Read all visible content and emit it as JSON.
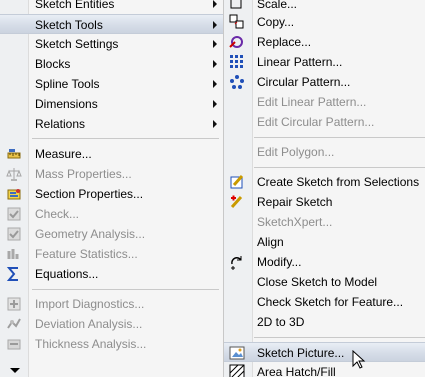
{
  "left_menu": {
    "items": [
      {
        "label": "Sketch Entities",
        "submenu": true
      },
      {
        "label": "Sketch Tools",
        "submenu": true,
        "highlighted": true
      },
      {
        "label": "Sketch Settings",
        "submenu": true
      },
      {
        "label": "Blocks",
        "submenu": true
      },
      {
        "label": "Spline Tools",
        "submenu": true
      },
      {
        "label": "Dimensions",
        "submenu": true
      },
      {
        "label": "Relations",
        "submenu": true
      },
      {
        "label": "Measure...",
        "icon": "measure-icon"
      },
      {
        "label": "Mass Properties...",
        "icon": "mass-properties-icon",
        "disabled": true
      },
      {
        "label": "Section Properties...",
        "icon": "section-properties-icon"
      },
      {
        "label": "Check...",
        "icon": "check-icon",
        "disabled": true
      },
      {
        "label": "Geometry Analysis...",
        "icon": "geometry-analysis-icon",
        "disabled": true
      },
      {
        "label": "Feature Statistics...",
        "icon": "feature-statistics-icon",
        "disabled": true
      },
      {
        "label": "Equations...",
        "icon": "sigma-icon"
      },
      {
        "label": "Import Diagnostics...",
        "icon": "import-diagnostics-icon",
        "disabled": true
      },
      {
        "label": "Deviation  Analysis...",
        "icon": "deviation-analysis-icon",
        "disabled": true
      },
      {
        "label": "Thickness Analysis...",
        "icon": "thickness-analysis-icon",
        "disabled": true
      }
    ]
  },
  "right_menu": {
    "items": [
      {
        "label": "Scale...",
        "icon": "scale-icon"
      },
      {
        "label": "Copy...",
        "icon": "copy-icon"
      },
      {
        "label": "Replace...",
        "icon": "replace-icon"
      },
      {
        "label": "Linear Pattern...",
        "icon": "linear-pattern-icon"
      },
      {
        "label": "Circular Pattern...",
        "icon": "circular-pattern-icon"
      },
      {
        "label": "Edit Linear Pattern...",
        "disabled": true
      },
      {
        "label": "Edit Circular Pattern...",
        "disabled": true
      },
      {
        "label": "Edit Polygon...",
        "disabled": true
      },
      {
        "label": "Create Sketch from Selections",
        "icon": "create-sketch-icon"
      },
      {
        "label": "Repair Sketch",
        "icon": "repair-sketch-icon"
      },
      {
        "label": "SketchXpert...",
        "disabled": true
      },
      {
        "label": "Align"
      },
      {
        "label": "Modify...",
        "icon": "modify-icon"
      },
      {
        "label": "Close Sketch to Model"
      },
      {
        "label": "Check Sketch for Feature..."
      },
      {
        "label": "2D to 3D"
      },
      {
        "label": "Sketch Picture...",
        "icon": "sketch-picture-icon",
        "highlighted": true
      },
      {
        "label": "Area Hatch/Fill",
        "icon": "area-hatch-icon"
      }
    ]
  },
  "colors": {
    "menu_background": "#f5f5f5",
    "disabled_text": "#8d8d8d",
    "highlight": "#d6dde8"
  }
}
